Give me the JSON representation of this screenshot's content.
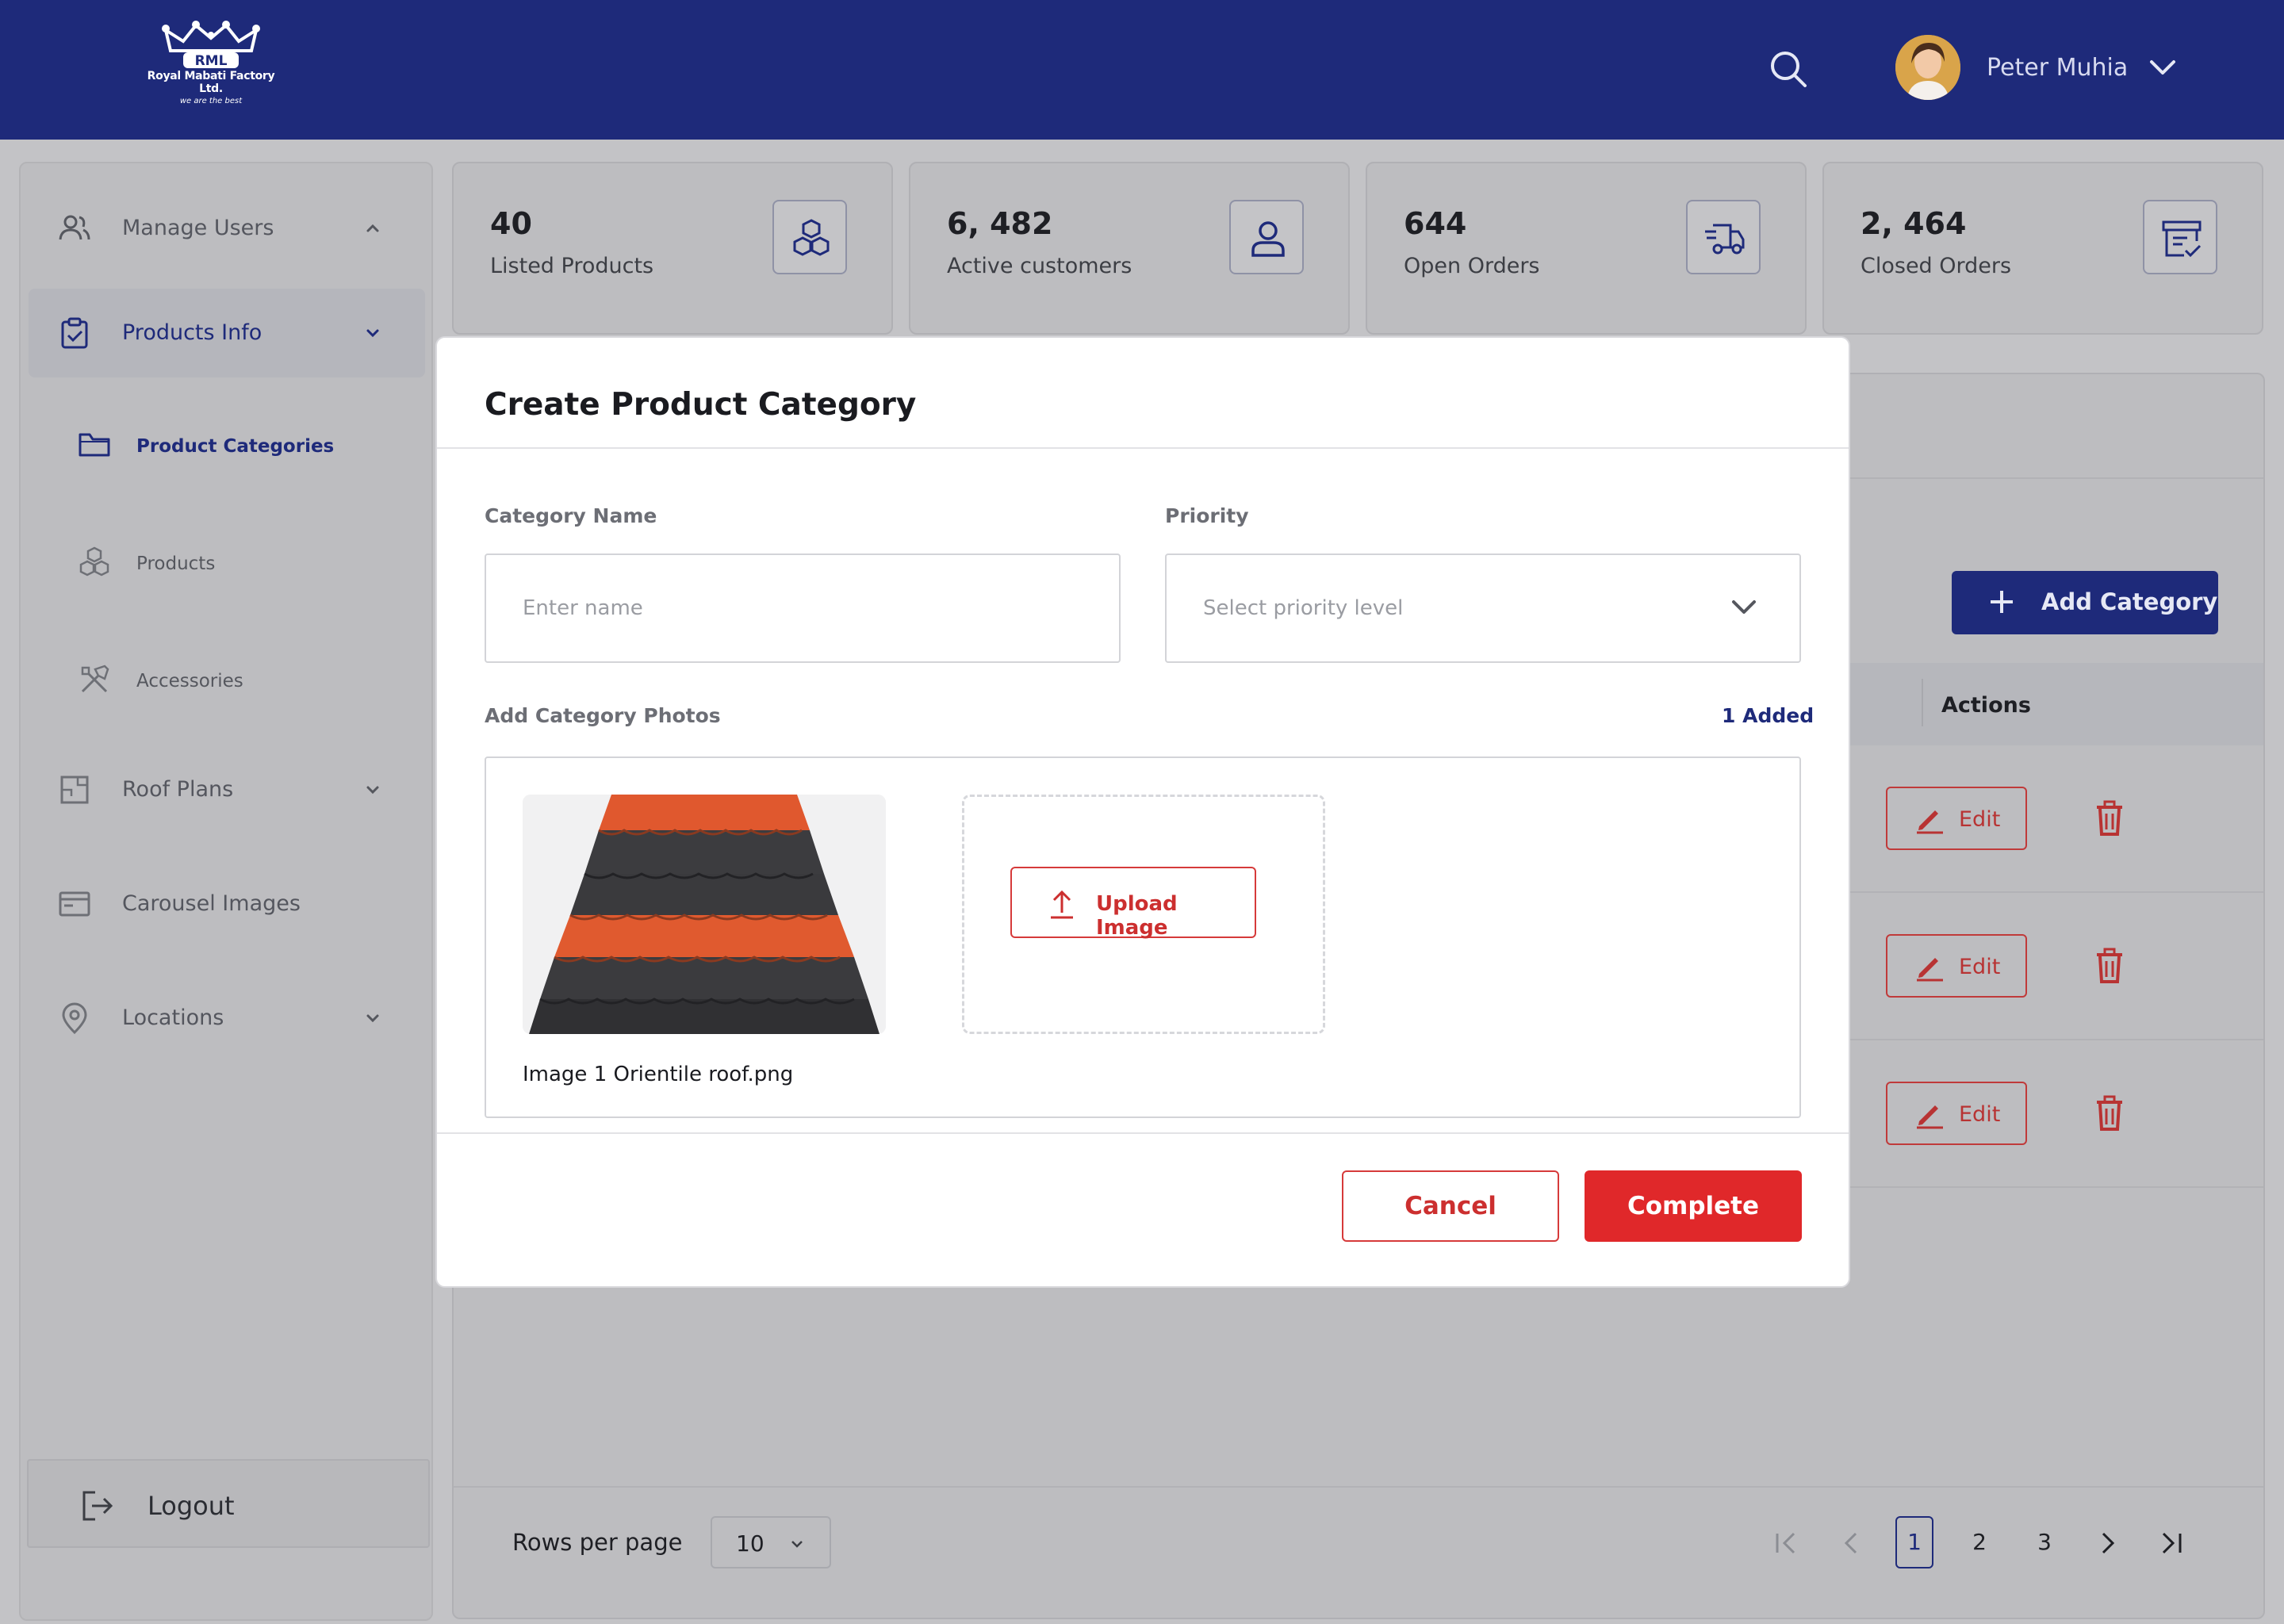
{
  "header": {
    "logo": {
      "brand": "Royal Mabati Factory Ltd.",
      "tagline": "we are the best",
      "monogram": "RML"
    },
    "user": {
      "name": "Peter Muhia"
    },
    "icons": {
      "search": "search-icon",
      "user_menu": "chevron-down-icon"
    }
  },
  "sidebar": {
    "items": [
      {
        "label": "Manage Users",
        "icon": "users-icon"
      },
      {
        "label": "Products Info",
        "icon": "clipboard-check-icon",
        "active": true
      },
      {
        "label": "Product Categories",
        "icon": "folder-icon",
        "active": true
      },
      {
        "label": "Products",
        "icon": "cubes-icon"
      },
      {
        "label": "Accessories",
        "icon": "tools-icon"
      },
      {
        "label": "Roof Plans",
        "icon": "floor-plan-icon"
      },
      {
        "label": "Carousel Images",
        "icon": "browser-window-icon"
      },
      {
        "label": "Locations",
        "icon": "map-pin-icon"
      }
    ],
    "logout": {
      "label": "Logout",
      "icon": "logout-icon"
    }
  },
  "stats": [
    {
      "value": "40",
      "label": "Listed Products",
      "icon": "cubes-icon"
    },
    {
      "value": "6, 482",
      "label": "Active customers",
      "icon": "user-icon"
    },
    {
      "value": "644",
      "label": "Open Orders",
      "icon": "delivery-truck-icon"
    },
    {
      "value": "2, 464",
      "label": "Closed Orders",
      "icon": "archive-check-icon"
    }
  ],
  "main": {
    "add_button": "Add Category",
    "table": {
      "actions_header": "Actions",
      "rows": [
        {
          "edit_label": "Edit"
        },
        {
          "edit_label": "Edit"
        },
        {
          "edit_label": "Edit"
        }
      ]
    },
    "pagination": {
      "rows_per_page_label": "Rows per page",
      "rows_per_page_value": "10",
      "pages": [
        "1",
        "2",
        "3"
      ],
      "current_page": "1"
    }
  },
  "modal": {
    "title": "Create Product Category",
    "category_name": {
      "label": "Category Name",
      "placeholder": "Enter name",
      "value": ""
    },
    "priority": {
      "label": "Priority",
      "placeholder": "Select priority level"
    },
    "photos": {
      "label": "Add Category Photos",
      "added_count": "1 Added",
      "items": [
        {
          "caption": "Image 1 Orientile roof.png"
        }
      ],
      "upload_label": "Upload Image"
    },
    "cancel_label": "Cancel",
    "complete_label": "Complete"
  },
  "colors": {
    "brand_navy": "#1e2a7a",
    "accent_red": "#e0282a",
    "overlay_gray": "#c3c3c6"
  }
}
